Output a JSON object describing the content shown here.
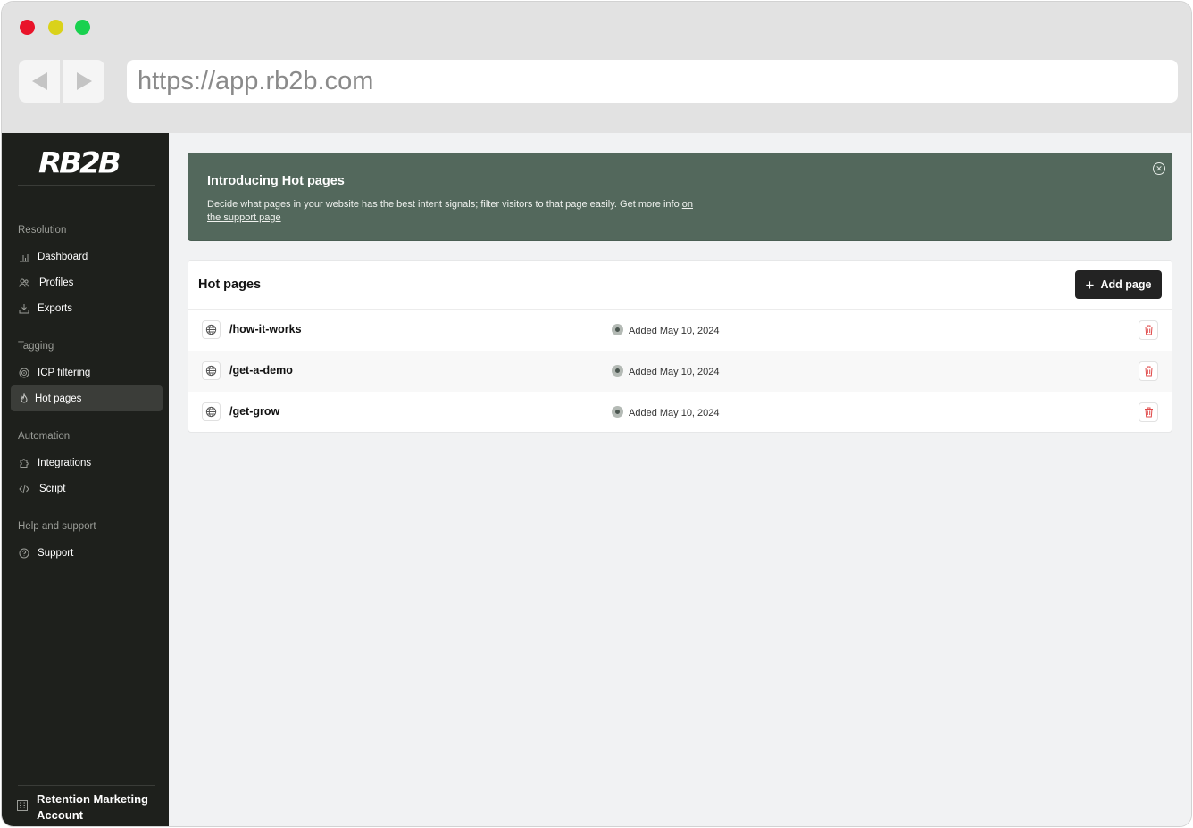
{
  "browser": {
    "url": "https://app.rb2b.com"
  },
  "sidebar": {
    "logo": "RB2B",
    "sections": [
      {
        "label": "Resolution",
        "items": [
          {
            "label": "Dashboard",
            "icon": "chart-icon"
          },
          {
            "label": "Profiles",
            "icon": "users-icon"
          },
          {
            "label": "Exports",
            "icon": "download-icon"
          }
        ]
      },
      {
        "label": "Tagging",
        "items": [
          {
            "label": "ICP filtering",
            "icon": "target-icon"
          },
          {
            "label": "Hot pages",
            "icon": "flame-icon",
            "active": true
          }
        ]
      },
      {
        "label": "Automation",
        "items": [
          {
            "label": "Integrations",
            "icon": "puzzle-icon"
          },
          {
            "label": "Script",
            "icon": "code-icon"
          }
        ]
      },
      {
        "label": "Help and support",
        "items": [
          {
            "label": "Support",
            "icon": "help-icon"
          }
        ]
      }
    ],
    "account": {
      "name": "Retention Marketing Account",
      "icon": "building-icon"
    }
  },
  "banner": {
    "title": "Introducing Hot pages",
    "text": "Decide what pages in your website has the best intent signals; filter visitors to that page easily. Get more info",
    "link_text": "on the support page",
    "close_icon": "close-circle-icon"
  },
  "hot_pages": {
    "title": "Hot pages",
    "add_button_label": "Add page",
    "rows": [
      {
        "path": "/how-it-works",
        "added": "Added May 10, 2024"
      },
      {
        "path": "/get-a-demo",
        "added": "Added May 10, 2024"
      },
      {
        "path": "/get-grow",
        "added": "Added May 10, 2024"
      }
    ]
  },
  "colors": {
    "sidebar_bg": "#1e201c",
    "banner_bg": "#53685c",
    "delete_red": "#e04a4a",
    "button_dark": "#232323"
  }
}
